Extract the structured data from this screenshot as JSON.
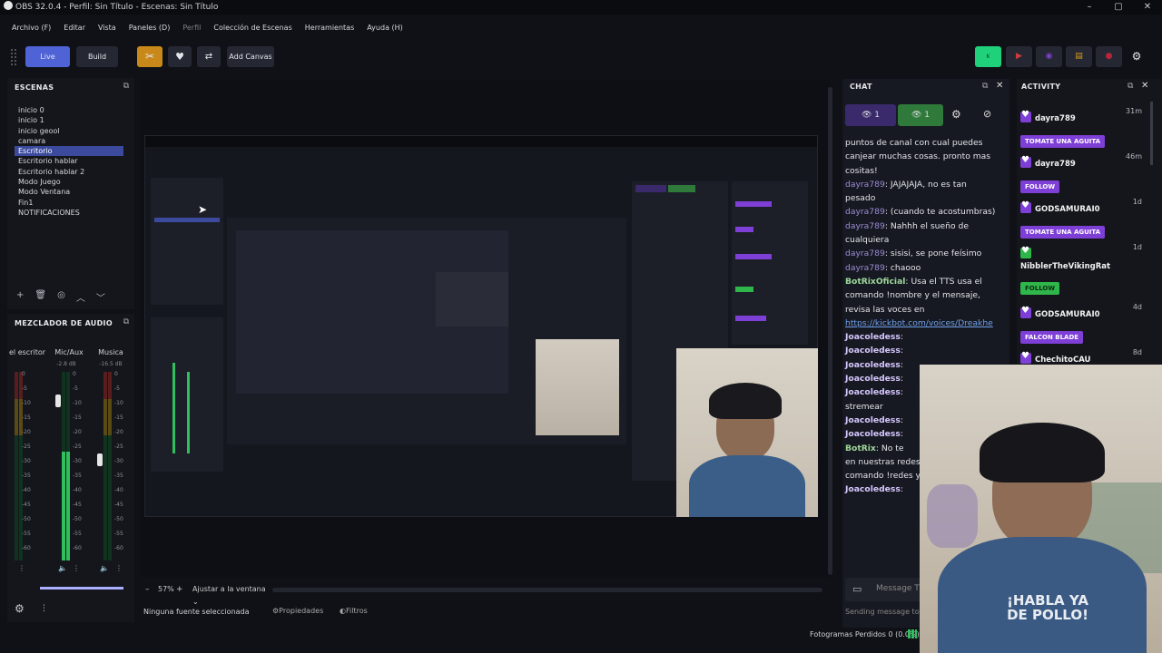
{
  "window": {
    "title": "OBS 32.0.4 - Perfil: Sin Título - Escenas: Sin Título",
    "controls": [
      "–",
      "▢",
      "✕"
    ]
  },
  "menu": {
    "items": [
      "Archivo (F)",
      "Editar",
      "Vista",
      "Paneles (D)",
      "Perfil",
      "Colección de Escenas",
      "Herramientas",
      "Ayuda (H)"
    ]
  },
  "toolbar": {
    "live": "Live",
    "build": "Build",
    "add_canvas": "Add Canvas"
  },
  "scenes": {
    "title": "ESCENAS",
    "items": [
      "inicio 0",
      "inicio 1",
      "inicio geool",
      "camara",
      "Escritorio",
      "Escritorio hablar",
      "Escritorio hablar 2",
      "Modo Juego",
      "Modo Ventana",
      "Fin1",
      "NOTIFICACIONES"
    ],
    "selected_index": 4
  },
  "mixer": {
    "title": "MEZCLADOR DE AUDIO",
    "channels": [
      {
        "name": "el escritor",
        "db": "",
        "level": 0.0
      },
      {
        "name": "Mic/Aux",
        "db": "-2.8 dB",
        "level": 0.85
      },
      {
        "name": "Musica",
        "db": "-16.5 dB",
        "level": 0.0
      }
    ],
    "scale": [
      "0",
      "-5",
      "-10",
      "-15",
      "-20",
      "-25",
      "-30",
      "-35",
      "-40",
      "-45",
      "-50",
      "-55",
      "-60"
    ]
  },
  "preview_controls": {
    "zoom": "57%",
    "fit": "Ajustar a la ventana",
    "minus": "–",
    "plus": "+"
  },
  "status": {
    "no_source": "Ninguna fuente seleccionada",
    "properties": "Propiedades",
    "filters": "Filtros",
    "dropped": "Fotogramas Perdidos 0 (0.0%)"
  },
  "chat": {
    "title": "CHAT",
    "viewers_a": "1",
    "viewers_b": "1",
    "messages": [
      {
        "user": "",
        "text": "puntos de canal con cual puedes canjear muchas cosas. pronto mas cositas!"
      },
      {
        "user": "dayra789",
        "text": ": JAJAJAJA, no es tan pesado"
      },
      {
        "user": "dayra789",
        "text": ": (cuando te acostumbras)"
      },
      {
        "user": "dayra789",
        "text": ": Nahhh el sueño de cualquiera"
      },
      {
        "user": "dayra789",
        "text": ": sisisi, se pone feísimo"
      },
      {
        "user": "dayra789",
        "text": ": chaooo"
      },
      {
        "user": "BotRixOficial",
        "text": ": Usa el TTS usa el comando !nombre y el mensaje, revisa las voces en"
      },
      {
        "user": "",
        "link": "https://kickbot.com/voices/Dreakhe"
      },
      {
        "user": "Joacoledess",
        "text": ":"
      },
      {
        "user": "Joacoledess",
        "text": ":"
      },
      {
        "user": "Joacoledess",
        "text": ":"
      },
      {
        "user": "Joacoledess",
        "text": ":"
      },
      {
        "user": "Joacoledess",
        "text": ":"
      },
      {
        "user": "",
        "text": "stremear"
      },
      {
        "user": "Joacoledess",
        "text": ":"
      },
      {
        "user": "Joacoledess",
        "text": ":"
      },
      {
        "user": "BotRix",
        "text": ": No te"
      },
      {
        "user": "",
        "text": "en nuestras redes"
      },
      {
        "user": "",
        "text": "comando !redes y"
      },
      {
        "user": "Joacoledess",
        "text": ":"
      }
    ],
    "input_placeholder": "Message T",
    "sending_as": "Sending message to:"
  },
  "activity": {
    "title": "ACTIVITY",
    "items": [
      {
        "name": "dayra789",
        "time": "31m",
        "badge": "TOMATE UNA AGUITA"
      },
      {
        "name": "dayra789",
        "time": "46m",
        "badge": "FOLLOW"
      },
      {
        "name": "GODSAMURAI0",
        "time": "1d",
        "badge": "TOMATE UNA AGUITA"
      },
      {
        "name": "NibblerTheVikingRat",
        "time": "1d",
        "badge": "FOLLOW"
      },
      {
        "name": "GODSAMURAI0",
        "time": "4d",
        "badge": "FALCON BLADE"
      },
      {
        "name": "ChechitoCAU",
        "time": "8d",
        "badge": ""
      }
    ]
  },
  "webcam": {
    "shirt_text": "¡HABLA YA DE POLLO!"
  },
  "colors": {
    "accent": "#3c4a9e",
    "live_button": "#4f63d6",
    "orange": "#c8891a",
    "green": "#2fbf5c",
    "purple": "#7d3fd6",
    "kick_green": "#1fd17a"
  }
}
